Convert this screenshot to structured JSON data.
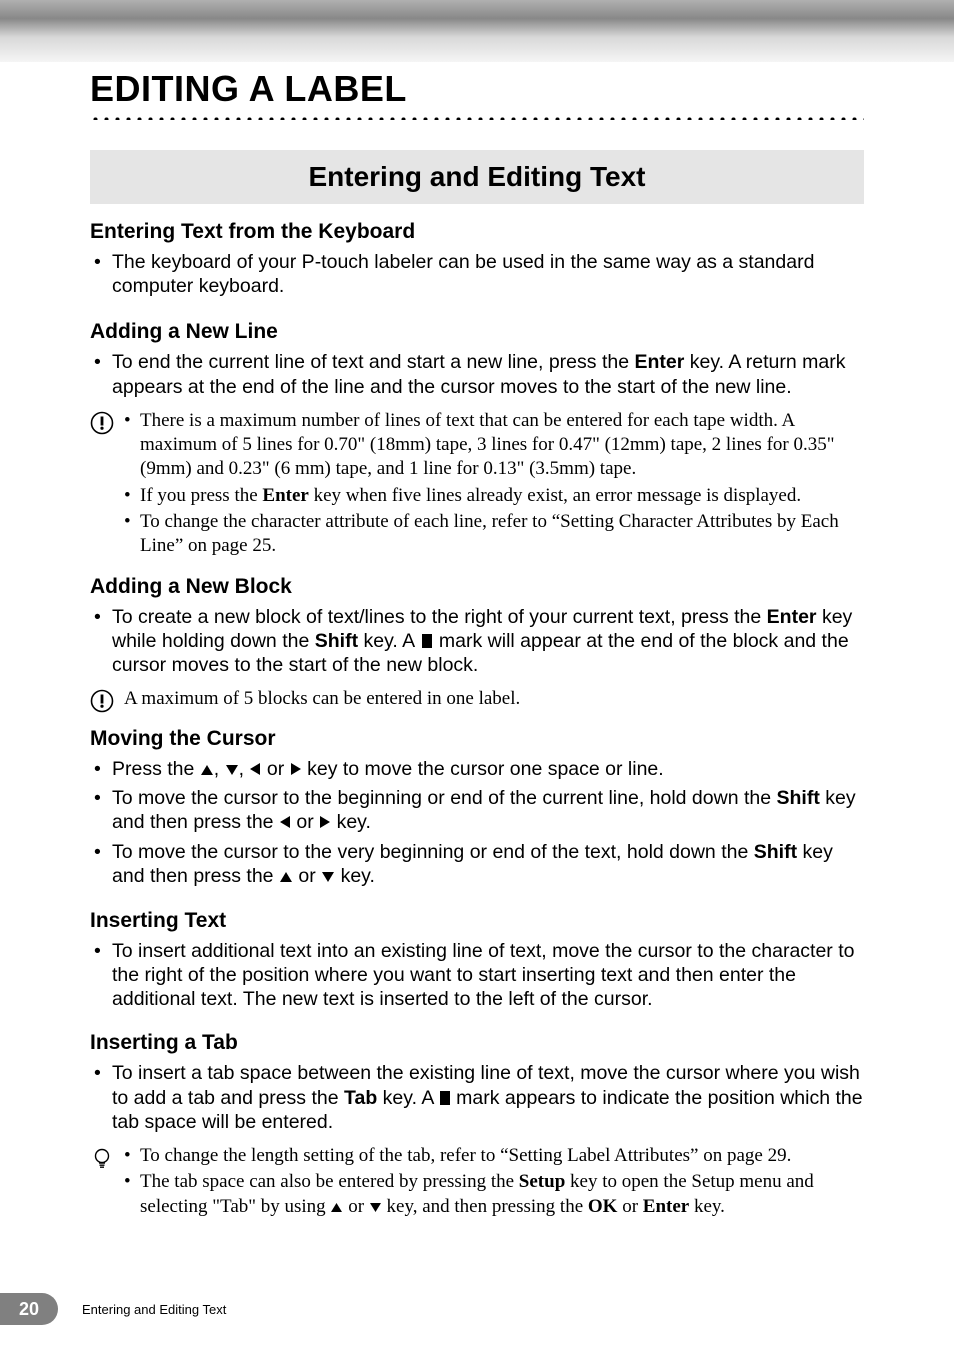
{
  "chapter_title": "EDITING A LABEL",
  "section_title": "Entering and Editing Text",
  "sub1": {
    "heading": "Entering Text from the Keyboard",
    "bullet1": "The keyboard of your P-touch labeler can be used in the same way as a standard computer keyboard."
  },
  "sub2": {
    "heading": "Adding a New Line",
    "bullet1_a": "To end the current line of text and start a new line, press the ",
    "bullet1_b": "Enter",
    "bullet1_c": " key. A return mark appears at the end of the line and the cursor moves to the start of the new line.",
    "note1": "There is a maximum number of lines of text that can be entered for each tape width. A maximum of 5 lines for 0.70\" (18mm) tape, 3 lines for 0.47\" (12mm) tape, 2 lines for 0.35\" (9mm) and 0.23\" (6 mm) tape, and 1 line for 0.13\" (3.5mm) tape.",
    "note2_a": "If you press the ",
    "note2_b": "Enter",
    "note2_c": " key when five lines already exist, an error message is displayed.",
    "note3": "To change the character attribute of each line, refer to “Setting Character Attributes by Each Line” on page 25."
  },
  "sub3": {
    "heading": "Adding a New Block",
    "bullet1_a": "To create a new block of text/lines to the right of your current text, press the ",
    "bullet1_b": "Enter",
    "bullet1_c": " key while holding down the ",
    "bullet1_d": "Shift",
    "bullet1_e": " key. A ",
    "bullet1_f": " mark will appear at the end of the block and the cursor moves to the start of the new block.",
    "note1": "A maximum of 5 blocks can be entered in one label."
  },
  "sub4": {
    "heading": "Moving the Cursor",
    "bullet1_a": "Press the ",
    "bullet1_b": " key to move the cursor one space or line.",
    "bullet2_a": "To move the cursor to the beginning or end of the current line, hold down the ",
    "bullet2_b": "Shift",
    "bullet2_c": " key and then press the ",
    "bullet2_d": " key.",
    "bullet3_a": "To move the cursor to the very beginning or end of the text, hold down the ",
    "bullet3_b": "Shift",
    "bullet3_c": " key and then press the ",
    "bullet3_d": " key."
  },
  "sub5": {
    "heading": "Inserting Text",
    "bullet1": "To insert additional text into an existing line of text, move the cursor to the character to the right of the position where you want to start inserting text and then enter the additional text. The new text is inserted to the left of the cursor."
  },
  "sub6": {
    "heading": "Inserting a Tab",
    "bullet1_a": "To insert a tab space between the existing line of text, move the cursor where you wish to add a tab and press the ",
    "bullet1_b": "Tab",
    "bullet1_c": " key. A ",
    "bullet1_d": " mark appears to indicate the position which the tab space will be entered.",
    "note1": "To change the length setting of the tab, refer to “Setting Label Attributes” on page 29.",
    "note2_a": "The tab space can also be entered by pressing the ",
    "note2_b": "Setup",
    "note2_c": " key to open the Setup menu and selecting \"Tab\" by using ",
    "note2_d": " key, and then pressing the ",
    "note2_e": "OK",
    "note2_f": " or ",
    "note2_g": "Enter",
    "note2_h": " key."
  },
  "footer": {
    "page": "20",
    "text": "Entering and Editing Text"
  },
  "glyphs": {
    "comma": ", ",
    "or": " or "
  }
}
